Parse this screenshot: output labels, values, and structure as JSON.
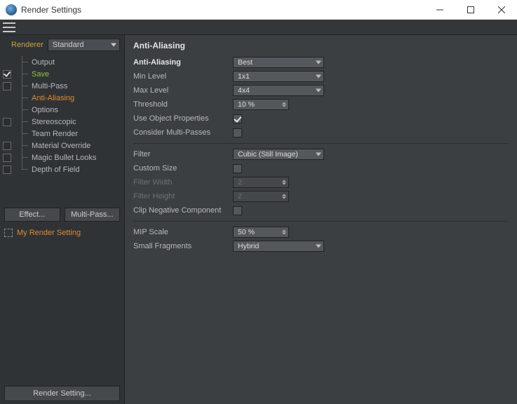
{
  "window": {
    "title": "Render Settings"
  },
  "sidebar": {
    "renderer_label": "Renderer",
    "renderer_value": "Standard",
    "tree": [
      {
        "label": "Output"
      },
      {
        "label": "Save"
      },
      {
        "label": "Multi-Pass"
      },
      {
        "label": "Anti-Aliasing"
      },
      {
        "label": "Options"
      },
      {
        "label": "Stereoscopic"
      },
      {
        "label": "Team Render"
      },
      {
        "label": "Material Override"
      },
      {
        "label": "Magic Bullet Looks"
      },
      {
        "label": "Depth of Field"
      }
    ],
    "effect_btn": "Effect...",
    "multipass_btn": "Multi-Pass...",
    "preset_name": "My Render Setting",
    "bottom_btn": "Render Setting..."
  },
  "panel": {
    "title": "Anti-Aliasing",
    "aa_label": "Anti-Aliasing",
    "aa_value": "Best",
    "min_label": "Min Level",
    "min_value": "1x1",
    "max_label": "Max Level",
    "max_value": "4x4",
    "threshold_label": "Threshold",
    "threshold_value": "10 %",
    "useobj_label": "Use Object Properties",
    "consider_label": "Consider Multi-Passes",
    "filter_label": "Filter",
    "filter_value": "Cubic (Still Image)",
    "custom_label": "Custom Size",
    "fw_label": "Filter Width",
    "fw_value": "2",
    "fh_label": "Filter Height",
    "fh_value": "2",
    "clip_label": "Clip Negative Component",
    "mip_label": "MIP Scale",
    "mip_value": "50 %",
    "frag_label": "Small Fragments",
    "frag_value": "Hybrid"
  }
}
